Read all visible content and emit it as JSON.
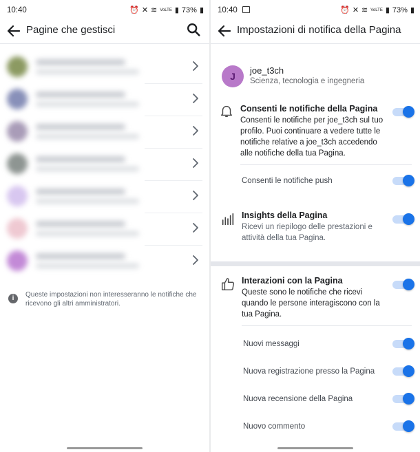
{
  "left": {
    "status": {
      "time": "10:40",
      "battery": "73%",
      "signal": "VoLTE"
    },
    "header": {
      "title": "Pagine che gestisci"
    },
    "rows": [
      {
        "color": "#8c9a62"
      },
      {
        "color": "#8890b9"
      },
      {
        "color": "#a99cb8"
      },
      {
        "color": "#8e9592"
      },
      {
        "color": "#d8c7f0"
      },
      {
        "color": "#efc9d2"
      },
      {
        "color": "#c38ad7"
      }
    ],
    "note": "Queste impostazioni non interesseranno le notifiche che ricevono gli altri amministratori."
  },
  "right": {
    "status": {
      "time": "10:40",
      "battery": "73%",
      "signal": "VoLTE"
    },
    "header": {
      "title": "Impostazioni di notifica della Pagina"
    },
    "page": {
      "initial": "J",
      "name": "joe_t3ch",
      "category": "Scienza, tecnologia e ingegneria"
    },
    "allow": {
      "title": "Consenti le notifiche della Pagina",
      "desc": "Consenti le notifiche per joe_t3ch sul tuo profilo. Puoi continuare a vedere tutte le notifiche relative a joe_t3ch accedendo alle notifiche della tua Pagina.",
      "push_label": "Consenti le notifiche push"
    },
    "insights": {
      "title": "Insights della Pagina",
      "desc": "Ricevi un riepilogo delle prestazioni e attività della tua Pagina."
    },
    "interactions": {
      "title": "Interazioni con la Pagina",
      "desc": "Queste sono le notifiche che ricevi quando le persone interagiscono con la tua Pagina.",
      "items": [
        "Nuovi messaggi",
        "Nuova registrazione presso la Pagina",
        "Nuova recensione della Pagina",
        "Nuovo commento"
      ]
    },
    "colors": {
      "accent": "#1a73e8",
      "track": "#c7dbf9"
    }
  }
}
